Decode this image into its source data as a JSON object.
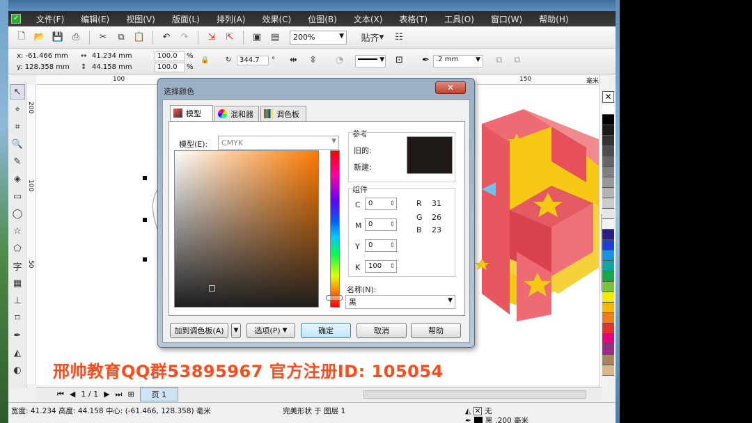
{
  "menu": [
    "文件(F)",
    "编辑(E)",
    "视图(V)",
    "版面(L)",
    "排列(A)",
    "效果(C)",
    "位图(B)",
    "文本(X)",
    "表格(T)",
    "工具(O)",
    "窗口(W)",
    "帮助(H)"
  ],
  "toolbar": {
    "zoom": "200%",
    "snap": "贴齐"
  },
  "props": {
    "x": "x: -61.466 mm",
    "y": "y: 128.358 mm",
    "w": "41.234 mm",
    "h": "44.158 mm",
    "sx": "100.0",
    "sy": "100.0",
    "pct": "%",
    "angle": "344.7",
    "deg": "°",
    "outline": ".2 mm"
  },
  "ruler": {
    "t100": "100",
    "t150": "150",
    "mm": "毫米",
    "l200": "200",
    "l100": "100",
    "l50": "50"
  },
  "dialog": {
    "title": "选择颜色",
    "tabs": [
      "模型",
      "混和器",
      "调色板"
    ],
    "model_label": "模型(E):",
    "model_value": "CMYK",
    "reference_label": "参考",
    "old_label": "旧的:",
    "new_label": "新建:",
    "old_color": "#1f1a17",
    "components_label": "组件",
    "cmyk": [
      {
        "k": "C",
        "v": "0"
      },
      {
        "k": "M",
        "v": "0"
      },
      {
        "k": "Y",
        "v": "0"
      },
      {
        "k": "K",
        "v": "100"
      }
    ],
    "rgb": [
      {
        "k": "R",
        "v": "31"
      },
      {
        "k": "G",
        "v": "26"
      },
      {
        "k": "B",
        "v": "23"
      }
    ],
    "name_label": "名称(N):",
    "name_value": "黑",
    "add_palette": "加到调色板(A)",
    "options": "选项(P)",
    "ok": "确定",
    "cancel": "取消",
    "help": "帮助"
  },
  "pages": {
    "counter": "1 / 1",
    "tab": "页 1"
  },
  "status": {
    "line1": "宽度: 41.234 高度: 44.158 中心: (-61.466, 128.358) 毫米",
    "line1b": "完美形状 于 图层 1",
    "none_label": "无",
    "fill_label": "黑",
    "outline_label": ".200 毫米"
  },
  "watermark": "邢帅教育QQ群53895967 官方注册ID: 105054",
  "palette": [
    "#ffffff",
    "#000000",
    "#1a1a1a",
    "#333333",
    "#4d4d4d",
    "#666666",
    "#808080",
    "#999999",
    "#b3b3b3",
    "#cccccc",
    "#e6e6e6",
    "#f2f2f2",
    "#2b1d86",
    "#1c3fd6",
    "#1793e0",
    "#12a6a3",
    "#18a848",
    "#7cc23a",
    "#f5e900",
    "#f6b800",
    "#ee7d1b",
    "#e6332a",
    "#e5007e",
    "#9b2b8c",
    "#a6875b",
    "#d9b98a"
  ]
}
